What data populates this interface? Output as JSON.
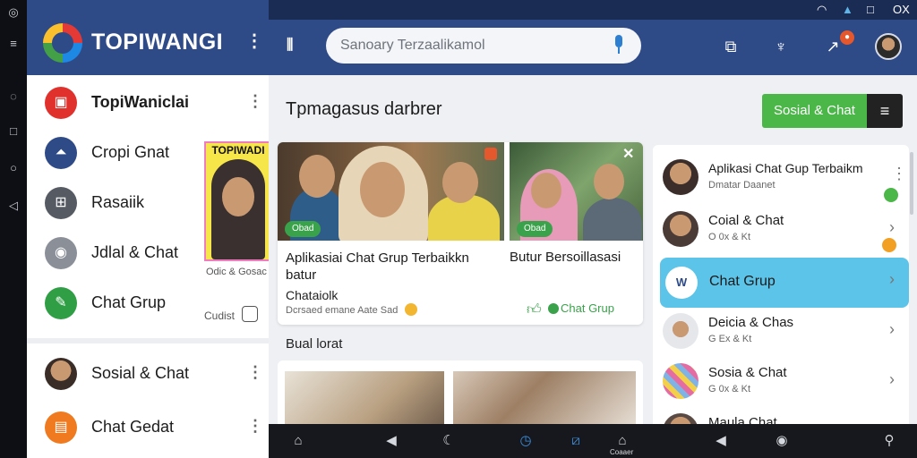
{
  "app": {
    "name": "TOPIWANGI"
  },
  "status": {
    "battery": "▲",
    "clock": "OX"
  },
  "drawer": {
    "items": [
      {
        "label": "TopiWaniclai",
        "icon": "stop-icon",
        "color": "#e0312c"
      },
      {
        "label": "Cropi Gnat",
        "icon": "tent-icon",
        "color": "#2e4a87"
      },
      {
        "label": "Rasaiik",
        "icon": "cart-icon",
        "color": "#555a63"
      },
      {
        "label": "Jdlal & Chat",
        "icon": "location-icon",
        "color": "#8a8f98"
      },
      {
        "label": "Chat Grup",
        "icon": "edit-icon",
        "color": "#2f9e44"
      },
      {
        "label": "Sosial & Chat",
        "icon": "avatar-icon",
        "color": "#c99a72"
      },
      {
        "label": "Chat Gedat",
        "icon": "chat-icon",
        "color": "#ef7a1f"
      }
    ],
    "card_title": "TOPIWADI",
    "card_sub": "Odic & Gosac",
    "side_label": "Cudist"
  },
  "search": {
    "placeholder": "Sanoary Terzaalikamol"
  },
  "main": {
    "title": "Tpmagasus darbrer",
    "primary_button": "Sosial & Chat",
    "post": {
      "heading_left": "Aplikasiai Chat Grup Terbaikkn batur",
      "heading_right": "Butur Bersoillasasi",
      "subheading": "Chataiolk",
      "meta": "Dcrsaed emane Aate Sad",
      "tag": "Chat Grup",
      "badge": "Obad"
    },
    "section_label": "Bual lorat"
  },
  "right_list": [
    {
      "title": "Aplikasi Chat Gup Terbaikm",
      "sub": "Dmatar Daanet",
      "avatar": "#3b2e2a",
      "dot": "#4cb749",
      "chevron": "⋮",
      "active": false
    },
    {
      "title": "Coial & Chat",
      "sub": "O 0x & Kt",
      "avatar": "#4a3b36",
      "dot": "#f2a024",
      "chevron": "›",
      "active": false
    },
    {
      "title": "Chat Grup",
      "sub": "",
      "avatar": "#ffffff",
      "dot": "",
      "chevron": "›",
      "active": true
    },
    {
      "title": "Deicia & Chas",
      "sub": "G Ex & Kt",
      "avatar": "#e5e7ea",
      "dot": "",
      "chevron": "›",
      "active": false
    },
    {
      "title": "Sosia & Chat",
      "sub": "G 0x & Kt",
      "avatar": "#7fb2e5",
      "dot": "",
      "chevron": "›",
      "active": false
    },
    {
      "title": "Maula Chat",
      "sub": "",
      "avatar": "#5a4a44",
      "dot": "",
      "chevron": "›",
      "active": false
    }
  ],
  "bottom_nav": {
    "active_label": "Coaaer"
  }
}
